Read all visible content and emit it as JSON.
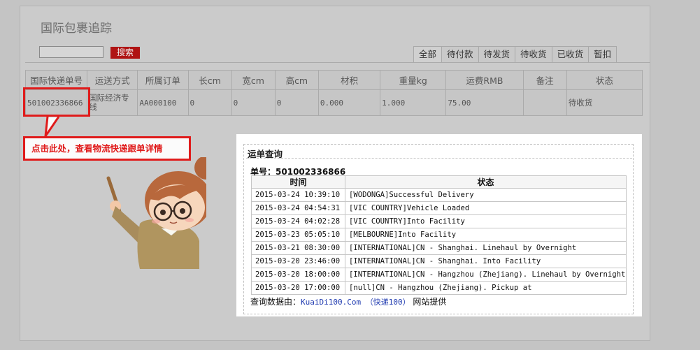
{
  "header": {
    "title": "国际包裹追踪"
  },
  "search": {
    "value": "",
    "button_label": "搜索"
  },
  "tabs": [
    {
      "label": "全部",
      "active": true
    },
    {
      "label": "待付款",
      "active": false
    },
    {
      "label": "待发货",
      "active": false
    },
    {
      "label": "待收货",
      "active": false
    },
    {
      "label": "已收货",
      "active": false
    },
    {
      "label": "暂扣",
      "active": false
    }
  ],
  "table": {
    "columns": [
      "国际快递单号",
      "运送方式",
      "所属订单",
      "长cm",
      "宽cm",
      "高cm",
      "材积",
      "重量kg",
      "运费RMB",
      "备注",
      "状态"
    ],
    "row": {
      "tracking_no": "501002336866",
      "method": "国际经济专线",
      "order": "AA000100",
      "length": "0",
      "width": "0",
      "height": "0",
      "volume": "0.000",
      "weight": "1.000",
      "fee": "75.00",
      "note": "",
      "status": "待收货"
    }
  },
  "callout": {
    "text": "点击此处，查看物流快递跟单详情"
  },
  "popup": {
    "title": "运单查询",
    "waybill_label": "单号：",
    "waybill_no": "501002336866",
    "columns": [
      "时间",
      "状态"
    ],
    "rows": [
      {
        "time": "2015-03-24 10:39:10",
        "status": "[WODONGA]Successful Delivery"
      },
      {
        "time": "2015-03-24 04:54:31",
        "status": "[VIC COUNTRY]Vehicle Loaded"
      },
      {
        "time": "2015-03-24 04:02:28",
        "status": "[VIC COUNTRY]Into Facility"
      },
      {
        "time": "2015-03-23 05:05:10",
        "status": "[MELBOURNE]Into Facility"
      },
      {
        "time": "2015-03-21 08:30:00",
        "status": "[INTERNATIONAL]CN - Shanghai. Linehaul by Overnight"
      },
      {
        "time": "2015-03-20 23:46:00",
        "status": "[INTERNATIONAL]CN - Shanghai. Into Facility"
      },
      {
        "time": "2015-03-20 18:00:00",
        "status": "[INTERNATIONAL]CN - Hangzhou (Zhejiang). Linehaul by Overnight"
      },
      {
        "time": "2015-03-20 17:00:00",
        "status": "[null]CN - Hangzhou (Zhejiang). Pickup at"
      }
    ],
    "footer_prefix": "查询数据由：",
    "footer_source": "KuaiDi100.Com （快递100）",
    "footer_suffix": " 网站提供"
  },
  "colors": {
    "accent_red": "#e01b1b",
    "button_red": "#b01414",
    "link_blue": "#1f2fa0"
  }
}
